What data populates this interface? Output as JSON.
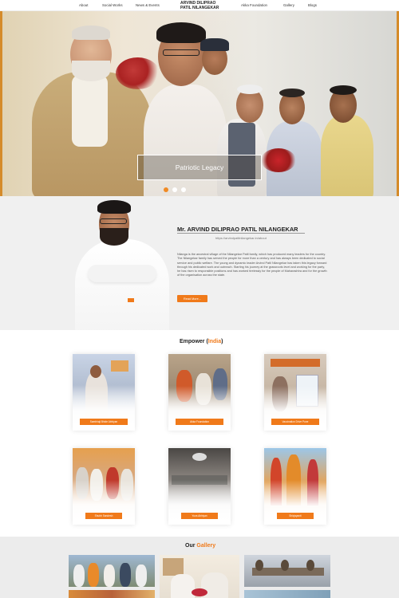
{
  "nav": {
    "about": "About",
    "social_works": "Social Works",
    "news_events": "News & Events",
    "logo_line1": "ARVIND DILIPRAO",
    "logo_line2": "PATIL NILANGEKAR",
    "foundation": "Akka Foundation",
    "gallery": "Gallery",
    "blogs": "Blogs"
  },
  "hero": {
    "caption": "Patriotic Legacy",
    "slides": 3,
    "active_slide": 1
  },
  "about": {
    "title": "Mr. ARVIND DILIPRAO PATIL NILANGEKAR",
    "url": "https://arvindpatilnilangekar.in/about",
    "text": "Nilanga is the ancestral village of the Nilangekar Patil family, which has produced many leaders for the country. The Nilangekar family has served the people for more than a century and has always been dedicated to social service and public welfare. The young and dynamic leader Arvind Patil Nilangekar has taken this legacy forward through his dedicated work and outreach. Starting his journey at the grassroots level and working for the party, he has risen to responsible positions and has worked tirelessly for the people of Maharashtra and for the growth of the organisation across the state.",
    "button": "Read More..."
  },
  "empower": {
    "title_prefix": "Empower",
    "title_highlight": "India",
    "cards": [
      {
        "label": "Sambhaji Bhide Abhiyan"
      },
      {
        "label": "Akka Foundation"
      },
      {
        "label": "Vaccination Drive Pune"
      },
      {
        "label": "Shubh Sandesh"
      },
      {
        "label": "Yuva Abhiyan"
      },
      {
        "label": "Shivjayanti"
      }
    ]
  },
  "gallery": {
    "title_prefix": "Our",
    "title_highlight": "Gallery"
  },
  "colors": {
    "accent": "#f07a1a",
    "frame": "#d58b2a"
  }
}
